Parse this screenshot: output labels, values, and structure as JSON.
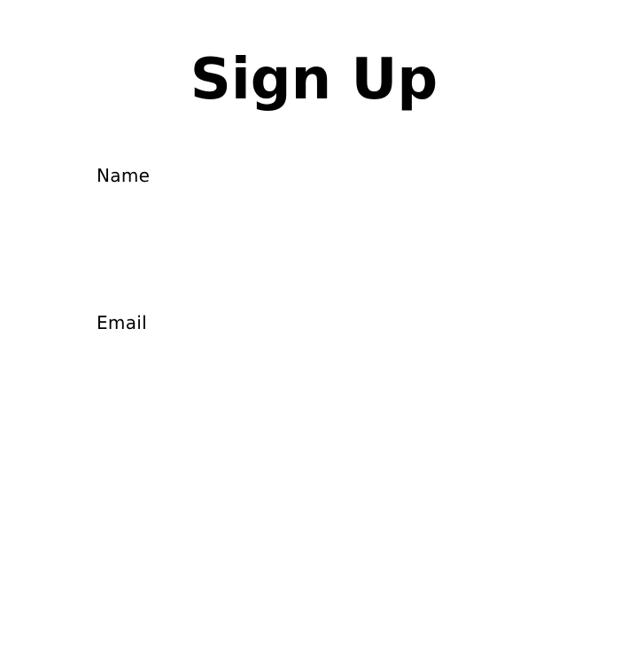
{
  "page": {
    "title": "Sign Up"
  },
  "form": {
    "name": {
      "label": "Name",
      "value": "",
      "placeholder": ""
    },
    "email": {
      "label": "Email",
      "value": "",
      "placeholder": ""
    }
  },
  "colors": {
    "background": "#ffffff",
    "text": "#000000"
  }
}
